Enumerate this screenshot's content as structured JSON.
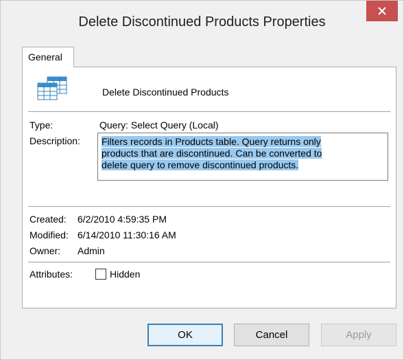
{
  "window": {
    "title": "Delete Discontinued Products Properties",
    "close_glyph": "×"
  },
  "tabs": [
    {
      "label": "General",
      "selected": true
    }
  ],
  "general": {
    "icon": "query-table-icon",
    "query_name": "Delete Discontinued Products",
    "type_label": "Type:",
    "type_value": "Query: Select Query (Local)",
    "description_label": "Description:",
    "description_lines": [
      "Filters records in Products table. Query returns only",
      "products that are discontinued. Can be converted to",
      "delete query to remove discontinued products."
    ],
    "created_label": "Created:",
    "created_value": "6/2/2010 4:59:35 PM",
    "modified_label": "Modified:",
    "modified_value": "6/14/2010 11:30:16 AM",
    "owner_label": "Owner:",
    "owner_value": "Admin",
    "attributes_label": "Attributes:",
    "hidden_checkbox_label": "Hidden",
    "hidden_checked": false
  },
  "buttons": {
    "ok": "OK",
    "cancel": "Cancel",
    "apply": "Apply"
  },
  "colors": {
    "close_button": "#c75050",
    "selection": "#99c9ef",
    "default_button_border": "#3c7fb1"
  }
}
